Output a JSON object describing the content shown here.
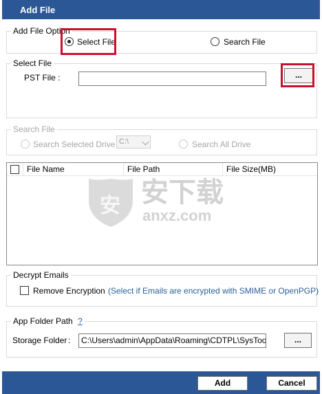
{
  "window": {
    "title": "Add File"
  },
  "file_option": {
    "legend": "Add File Option",
    "select_file_label": "Select File",
    "search_file_label": "Search File",
    "selected": "select"
  },
  "select_file": {
    "legend": "Select File",
    "pst_label": "PST File :",
    "pst_value": "",
    "browse_label": "..."
  },
  "search_file": {
    "legend": "Search File",
    "selected_drive_label": "Search Selected Drive",
    "drive_value": "C:\\",
    "all_drive_label": "Search All Drive"
  },
  "file_list": {
    "columns": [
      "File Name",
      "File Path",
      "File Size(MB)"
    ],
    "rows": []
  },
  "decrypt": {
    "legend": "Decrypt Emails",
    "remove_label": "Remove Encryption",
    "note": "(Select if Emails are encrypted with SMIME or OpenPGP)"
  },
  "app_folder": {
    "legend": "App Folder Path",
    "help_label": "?",
    "storage_label": "Storage Folder",
    "colon": ":",
    "storage_value": "C:\\Users\\admin\\AppData\\Roaming\\CDTPL\\SysTools C",
    "browse_label": "..."
  },
  "footer": {
    "add_label": "Add",
    "cancel_label": "Cancel"
  },
  "watermark": {
    "cn": "安下载",
    "domain": "anxz.com",
    "shield_char": "安"
  },
  "colors": {
    "titlebar": "#2b5797",
    "highlight": "#c8102e",
    "note": "#2a6099"
  }
}
